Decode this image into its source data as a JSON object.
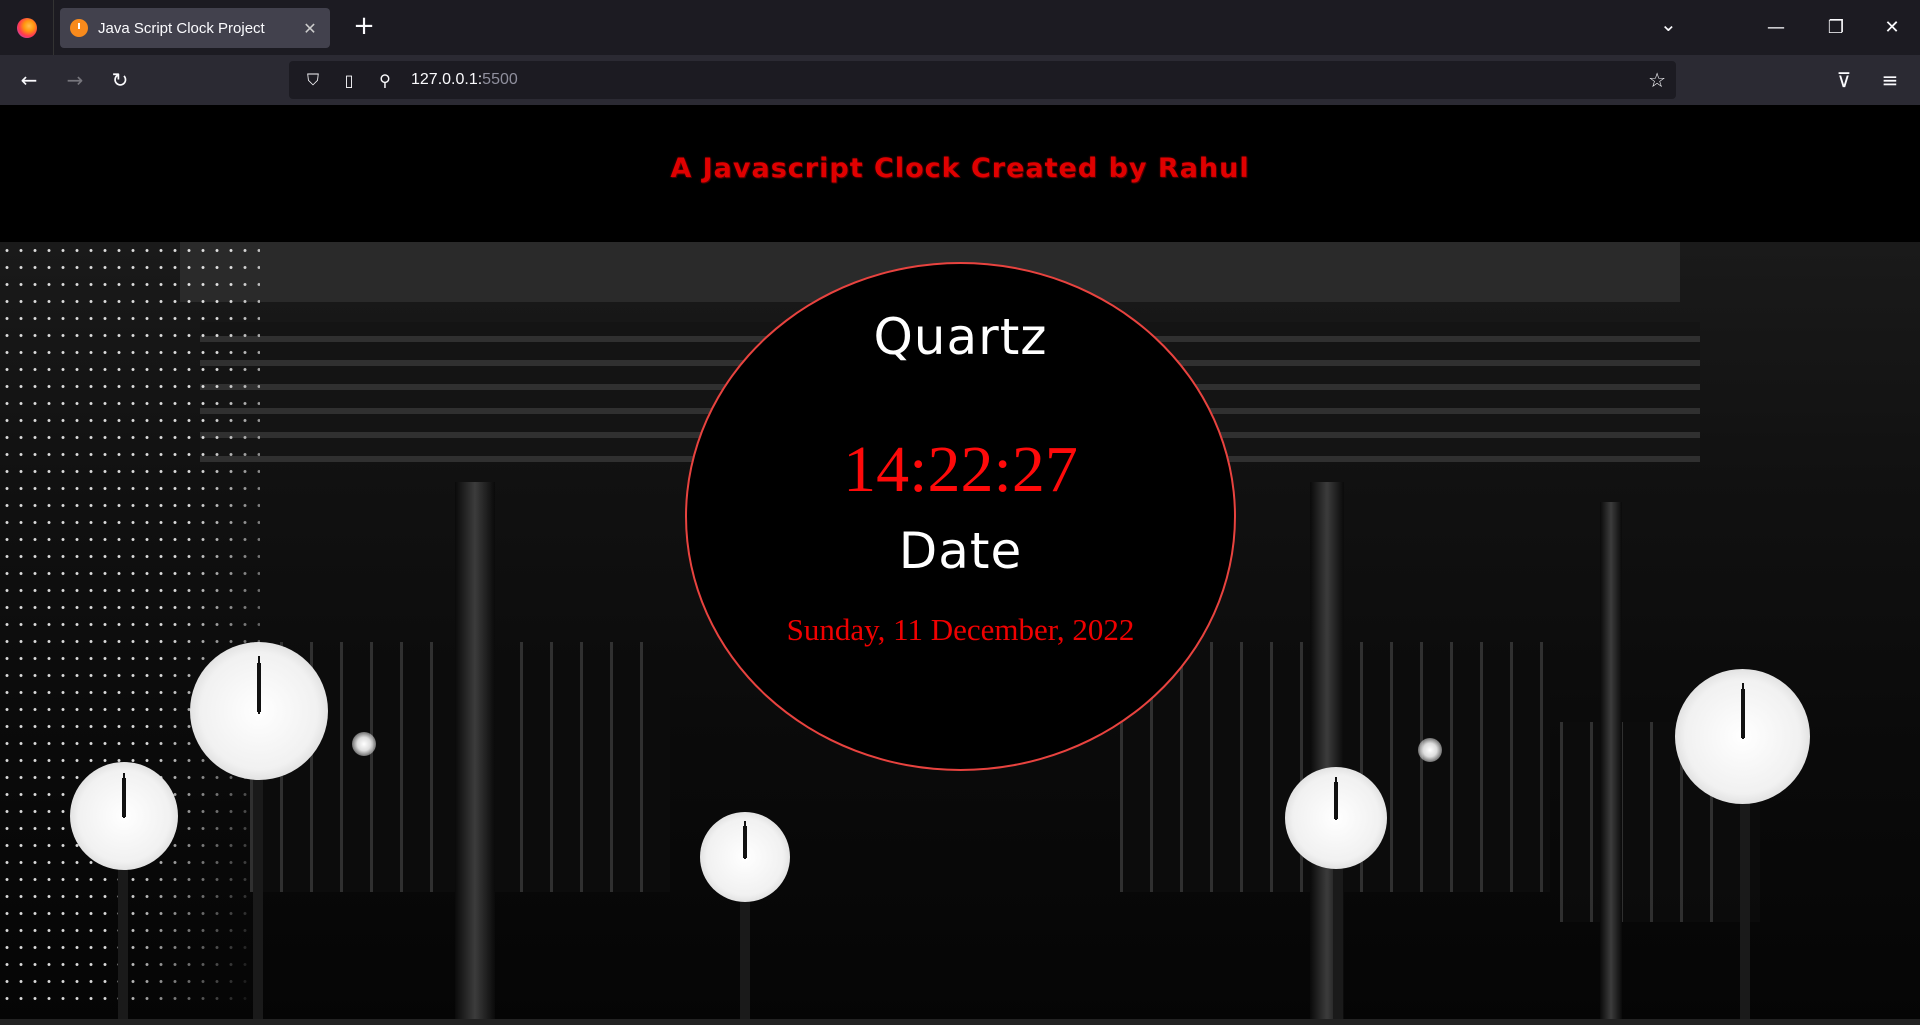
{
  "browser": {
    "tab_title": "Java Script Clock Project",
    "tab_close": "✕",
    "new_tab": "+",
    "url_host": "127.0.0.1:",
    "url_port": "5500"
  },
  "page": {
    "heading": "A Javascript Clock Created by Rahul",
    "time_label": "Quartz",
    "time": "14:22:27",
    "date_label": "Date",
    "date": "Sunday, 11 December, 2022"
  },
  "colors": {
    "accent_red": "#ff0a0a",
    "dial_border": "#e8433f"
  }
}
